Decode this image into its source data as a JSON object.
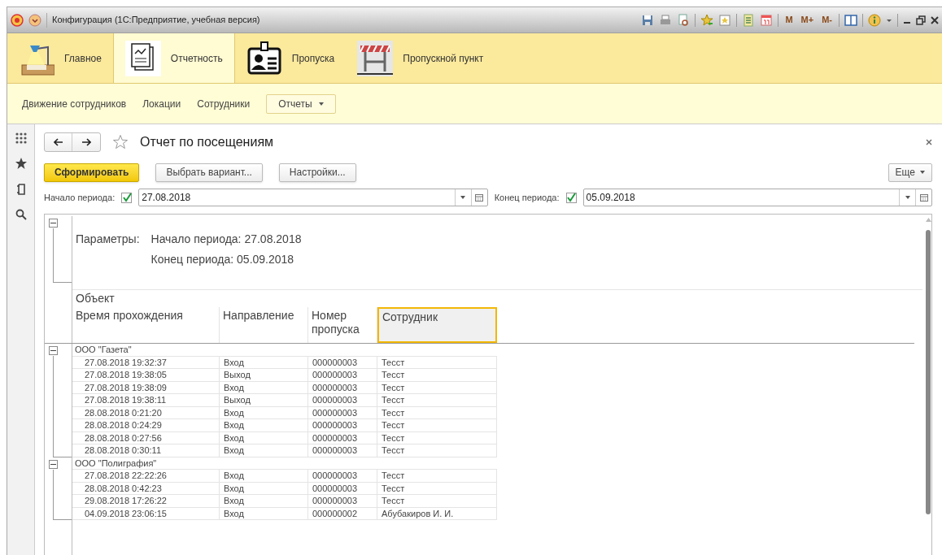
{
  "window": {
    "title": "Конфигурация  (1С:Предприятие, учебная версия)"
  },
  "toolbar": [
    {
      "kind": "icon"
    },
    {
      "kind": "icon"
    },
    {
      "kind": "icon"
    },
    {
      "kind": "sep"
    },
    {
      "kind": "icon"
    },
    {
      "kind": "icon"
    },
    {
      "kind": "sep"
    },
    {
      "kind": "icon"
    },
    {
      "kind": "icon"
    },
    {
      "kind": "sep"
    },
    {
      "kind": "text",
      "label": "M"
    },
    {
      "kind": "text",
      "label": "M+"
    },
    {
      "kind": "text",
      "label": "M-"
    },
    {
      "kind": "sep"
    },
    {
      "kind": "icon"
    },
    {
      "kind": "sep"
    },
    {
      "kind": "icon"
    }
  ],
  "sections": [
    {
      "label": "Главное",
      "selected": false
    },
    {
      "label": "Отчетность",
      "selected": true
    },
    {
      "label": "Пропуска",
      "selected": false
    },
    {
      "label": "Пропускной пункт",
      "selected": false
    }
  ],
  "nav_links": [
    "Движение сотрудников",
    "Локации",
    "Сотрудники"
  ],
  "nav_menu": "Отчеты",
  "form": {
    "title": "Отчет по посещениям",
    "favorite": false,
    "buttons": [
      {
        "label": "Сформировать",
        "default": true
      },
      {
        "label": "Выбрать вариант...",
        "default": false
      },
      {
        "label": "Настройки...",
        "default": false
      }
    ],
    "more": "Еще",
    "period": [
      {
        "label": "Начало периода:",
        "checked": true,
        "value": "27.08.2018"
      },
      {
        "label": "Конец периода:",
        "checked": true,
        "value": "05.09.2018"
      }
    ]
  },
  "report": {
    "params": {
      "expanded": true,
      "label": "Параметры:",
      "lines": [
        "Начало периода: 27.08.2018",
        "Конец периода: 05.09.2018"
      ]
    },
    "group_header": "Объект",
    "columns": [
      {
        "label": "Время прохождения",
        "selected": false
      },
      {
        "label": "Направление",
        "selected": false
      },
      {
        "label": "Номер пропуска",
        "selected": false
      },
      {
        "label": "Сотрудник",
        "selected": true
      }
    ],
    "groups": [
      {
        "name": "ООО \"Газета\"",
        "expanded": true,
        "rows": [
          [
            "27.08.2018 19:32:37",
            "Вход",
            "000000003",
            "Тесст"
          ],
          [
            "27.08.2018 19:38:05",
            "Выход",
            "000000003",
            "Тесст"
          ],
          [
            "27.08.2018 19:38:09",
            "Вход",
            "000000003",
            "Тесст"
          ],
          [
            "27.08.2018 19:38:11",
            "Выход",
            "000000003",
            "Тесст"
          ],
          [
            "28.08.2018 0:21:20",
            "Вход",
            "000000003",
            "Тесст"
          ],
          [
            "28.08.2018 0:24:29",
            "Вход",
            "000000003",
            "Тесст"
          ],
          [
            "28.08.2018 0:27:56",
            "Вход",
            "000000003",
            "Тесст"
          ],
          [
            "28.08.2018 0:30:11",
            "Вход",
            "000000003",
            "Тесст"
          ]
        ]
      },
      {
        "name": "ООО \"Полиграфия\"",
        "expanded": true,
        "rows": [
          [
            "27.08.2018 22:22:26",
            "Вход",
            "000000003",
            "Тесст"
          ],
          [
            "28.08.2018 0:42:23",
            "Вход",
            "000000003",
            "Тесст"
          ],
          [
            "29.08.2018 17:26:22",
            "Вход",
            "000000003",
            "Тесст"
          ],
          [
            "04.09.2018 23:06:15",
            "Вход",
            "000000002",
            "Абубакиров И. И."
          ]
        ]
      }
    ]
  }
}
